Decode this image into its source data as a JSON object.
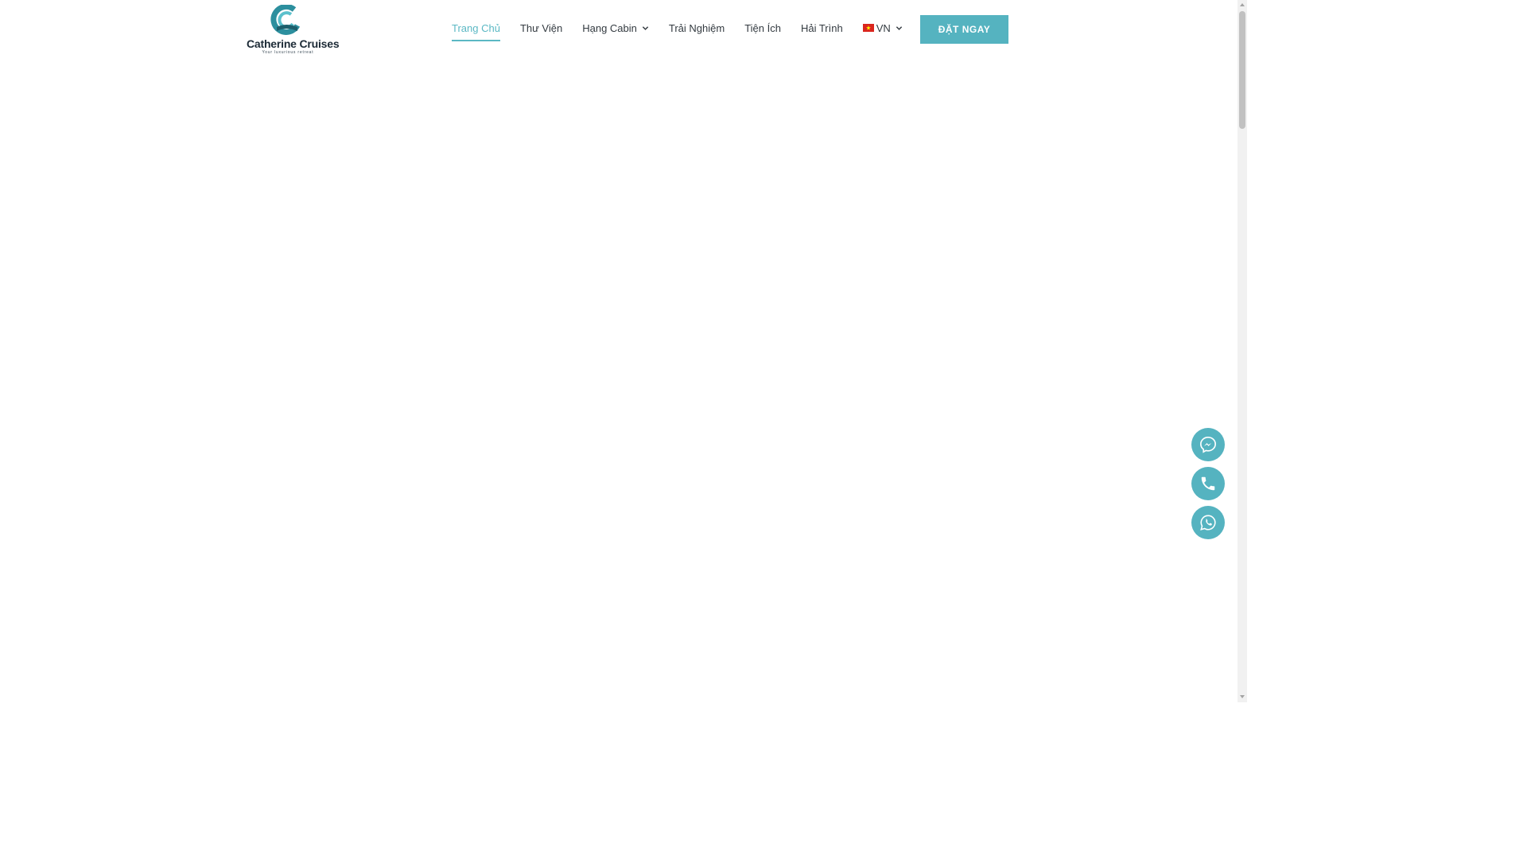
{
  "brand": {
    "name": "Catherine Cruises",
    "tagline": "Your luxurious retreat"
  },
  "nav": {
    "items": [
      {
        "label": "Trang Chủ",
        "active": true
      },
      {
        "label": "Thư Viện"
      },
      {
        "label": "Hạng Cabin",
        "dropdown": true
      },
      {
        "label": "Trải Nghiệm"
      },
      {
        "label": "Tiện Ích"
      },
      {
        "label": "Hải Trình"
      }
    ],
    "language": {
      "label": "VN",
      "icon": "vietnam-flag-icon"
    }
  },
  "cta": {
    "label": "ĐẶT NGAY"
  },
  "floating_contacts": [
    {
      "icon": "messenger-icon"
    },
    {
      "icon": "phone-icon"
    },
    {
      "icon": "whatsapp-icon"
    }
  ],
  "colors": {
    "accent": "#55b3c0",
    "text": "#333a40",
    "background": "#ffffff"
  }
}
